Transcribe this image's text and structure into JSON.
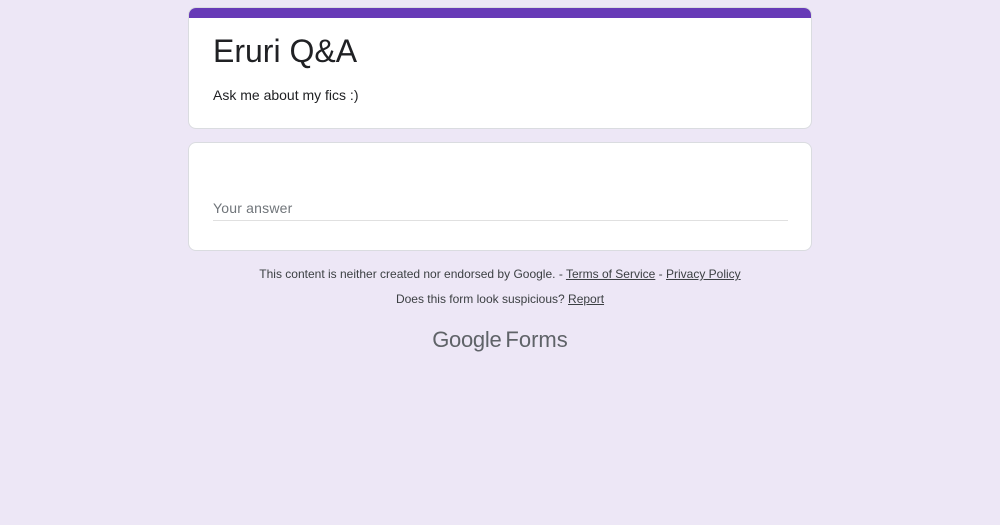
{
  "form": {
    "title": "Eruri Q&A",
    "description": "Ask me about my fics :)",
    "accent_color": "#673ab7",
    "background_color": "#ede7f6"
  },
  "question": {
    "answer_placeholder": "Your answer",
    "answer_value": ""
  },
  "footer": {
    "disclaimer": "This content is neither created nor endorsed by Google.",
    "separator": "-",
    "terms_label": "Terms of Service",
    "privacy_label": "Privacy Policy",
    "suspicious_text": "Does this form look suspicious?",
    "report_label": "Report"
  },
  "brand": {
    "google": "Google",
    "forms": "Forms"
  }
}
